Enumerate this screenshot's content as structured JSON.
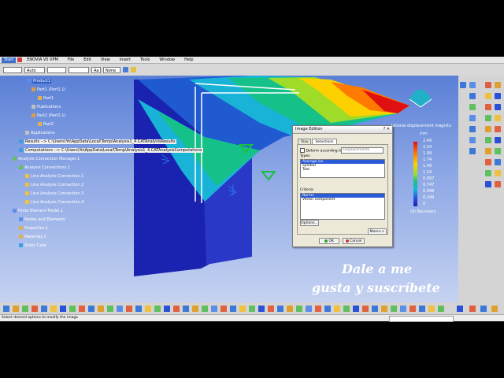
{
  "menu": {
    "start": "Start",
    "items": [
      "ENOVIA V5 VPM",
      "File",
      "Edit",
      "View",
      "Insert",
      "Tools",
      "Window",
      "Help"
    ]
  },
  "toolbar": {
    "combo1": "",
    "combo2": "Auto",
    "combo3": "",
    "combo4": "",
    "combo5": "Aa",
    "combo6": "None"
  },
  "tree": {
    "items": [
      {
        "label": "Product1",
        "selected": true
      },
      {
        "label": "Part1 (Part1.1)"
      },
      {
        "label": "Part1"
      },
      {
        "label": "Publications"
      },
      {
        "label": "Part2 (Part2.1)"
      },
      {
        "label": "Part2"
      },
      {
        "label": "Applications"
      },
      {
        "label": "Results --> C:\\Users\\Yo\\AppData\\Local\\Temp\\Analysis1_4.CATAnalysisResults"
      },
      {
        "label": "Computations --> C:\\Users\\Yo\\AppData\\Local\\Temp\\Analysis1_4.CATAnalysisComputations"
      },
      {
        "label": "Analysis Connection Manager.1"
      },
      {
        "label": "Analysis Connections.1"
      },
      {
        "label": "Line Analysis Connection.1"
      },
      {
        "label": "Line Analysis Connection.2"
      },
      {
        "label": "Line Analysis Connection.3"
      },
      {
        "label": "Line Analysis Connection.4"
      },
      {
        "label": "Finite Element Model.1"
      },
      {
        "label": "Nodes and Elements"
      },
      {
        "label": "Properties.1"
      },
      {
        "label": "Materials.1"
      },
      {
        "label": "Static Case"
      }
    ]
  },
  "dialog": {
    "title": "Image Edition",
    "title_buttons": "?   ✕",
    "tabs": [
      "Visu",
      "Selections"
    ],
    "checkbox_label": "Deform according to",
    "deform_value": "Displacements",
    "types_label": "Types",
    "types": [
      "Average iso",
      "Symbol",
      "Text"
    ],
    "types_selected": 0,
    "criteria_label": "Criteria",
    "criteria": [
      "Norms",
      "Vector component"
    ],
    "criteria_selected": 0,
    "options_button": "Options...",
    "more_button": "More>>",
    "ok_button": "OK",
    "cancel_button": "Cancel"
  },
  "legend": {
    "title": "lational displacement magnitu",
    "unit": "mm",
    "values": [
      "2.49",
      "2.24",
      "1.99",
      "1.74",
      "1.49",
      "1.24",
      "0.997",
      "0.747",
      "0.498",
      "0.249",
      "0"
    ],
    "footer": "On Boundary"
  },
  "subtitle": {
    "line1": "Dale a me",
    "line2": "gusta y suscríbete"
  },
  "status": {
    "message": "Select desired options to modify the image"
  },
  "colors": {
    "viewport_top": "#5a7fd6",
    "part_blue": "#1a22b0",
    "selection": "#2b5bd6"
  }
}
